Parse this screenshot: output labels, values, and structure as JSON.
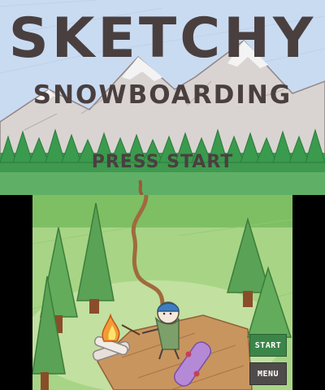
{
  "title": {
    "main": "SKETCHY",
    "sub": "SNOWBOARDING",
    "prompt": "PRESS START"
  },
  "buttons": {
    "start_label": "START",
    "menu_label": "MENU"
  },
  "colors": {
    "title_text": "#4a3f3f",
    "sky": "#c6d8f0",
    "grass": "#aad68a",
    "start_button": "#3c8548",
    "menu_button": "#4f4b4b"
  }
}
